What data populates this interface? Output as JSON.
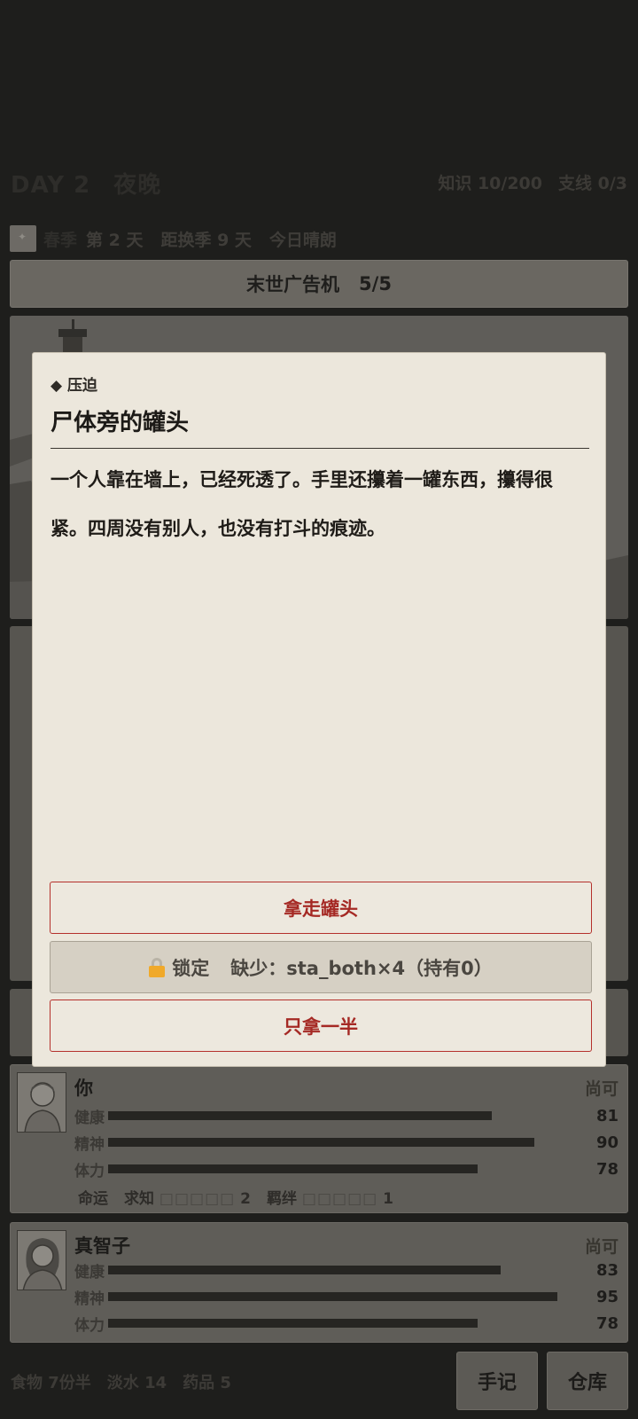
{
  "header": {
    "day": "DAY 2",
    "time": "夜晚",
    "knowledge": "知识 10/200",
    "sidequest": "支线 0/3"
  },
  "season": {
    "name": "春季",
    "day": "第 2 天",
    "to_change": "距换季 9 天",
    "weather": "今日晴朗"
  },
  "ad_machine": {
    "label": "末世广告机",
    "count": "5/5"
  },
  "modal": {
    "tag": "◆ 压迫",
    "title": "尸体旁的罐头",
    "body": "一个人靠在墙上，已经死透了。手里还攥着一罐东西，攥得很紧。四周没有别人，也没有打斗的痕迹。",
    "choices": {
      "take": "拿走罐头",
      "locked_label": "锁定",
      "locked_req": "缺少：sta_both×4（持有0）",
      "half": "只拿一半"
    }
  },
  "characters": [
    {
      "name": "你",
      "state": "尚可",
      "stats": [
        {
          "label": "健康",
          "value": 81
        },
        {
          "label": "精神",
          "value": 90
        },
        {
          "label": "体力",
          "value": 78
        }
      ],
      "fate": {
        "label": "命运",
        "curiosity_label": "求知",
        "curiosity_boxes": "□□□□□",
        "curiosity_value": "2",
        "bond_label": "羁绊",
        "bond_boxes": "□□□□□",
        "bond_value": "1"
      }
    },
    {
      "name": "真智子",
      "state": "尚可",
      "stats": [
        {
          "label": "健康",
          "value": 83
        },
        {
          "label": "精神",
          "value": 95
        },
        {
          "label": "体力",
          "value": 78
        }
      ]
    }
  ],
  "resources": {
    "food": "食物 7份半",
    "water": "淡水 14",
    "medicine": "药品 5"
  },
  "buttons": {
    "notes": "手记",
    "storage": "仓库"
  },
  "colors": {
    "modal_bg": "#ece7dc",
    "choice_red": "#a52924",
    "lock_yellow": "#f0a92a"
  },
  "icons": {
    "lock": "lock-icon",
    "season": "season-icon"
  }
}
